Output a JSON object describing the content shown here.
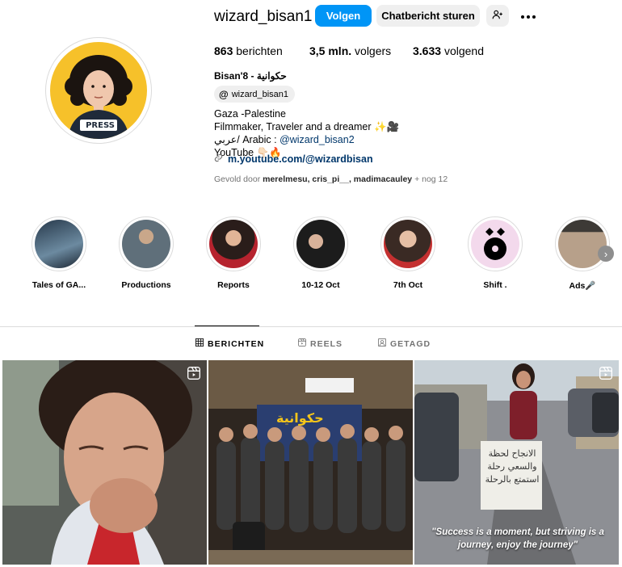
{
  "header": {
    "username": "wizard_bisan1",
    "follow_label": "Volgen",
    "message_label": "Chatbericht sturen",
    "icons": {
      "add_user": "person-add-icon",
      "more": "more-options-icon"
    }
  },
  "stats": {
    "posts_value": "863",
    "posts_label": "berichten",
    "followers_value": "3,5 mln.",
    "followers_label": "volgers",
    "following_value": "3.633",
    "following_label": "volgend"
  },
  "profile": {
    "full_name": "Bisan'8 - حكوانية",
    "threads_handle": "wizard_bisan1",
    "bio_line1": "Gaza -Palestine",
    "bio_line2": "Filmmaker, Traveler and a dreamer ✨🎥",
    "bio_line3_prefix": "عربي/ Arabic : ",
    "bio_line3_mention": "@wizard_bisan2",
    "bio_line4": "YouTube 👇🏻🔥",
    "link": "m.youtube.com/@wizardbisan",
    "followed_by_prefix": "Gevold door ",
    "followed_by_names": "merelmesu, cris_pi__, madimacauley",
    "followed_by_suffix": " + nog 12",
    "avatar_badge": "PRESS"
  },
  "highlights": [
    {
      "label": "Tales of GA..."
    },
    {
      "label": "Productions"
    },
    {
      "label": "Reports"
    },
    {
      "label": "10-12 Oct"
    },
    {
      "label": "7th Oct"
    },
    {
      "label": "Shift ."
    },
    {
      "label": "Ads🎤"
    }
  ],
  "tabs": {
    "posts": "BERICHTEN",
    "reels": "REELS",
    "tagged": "GETAGD"
  },
  "posts": {
    "post2_sign": "حكوانية",
    "post3_sign": "الانجاح لحظة والسعي رحلة استمتع بالرحلة",
    "post3_caption": "\"Success is a moment, but striving is a journey, enjoy the journey\""
  },
  "colors": {
    "primary": "#0095f6",
    "link": "#00376b",
    "secondary_button": "#efefef",
    "avatar_bg": "#f6c12a",
    "muted_text": "#737373"
  }
}
